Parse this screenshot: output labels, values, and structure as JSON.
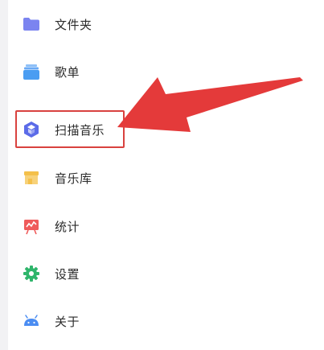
{
  "menu": {
    "items": [
      {
        "label": "文件夹",
        "icon": "folder-icon",
        "color": "#7b84f0"
      },
      {
        "label": "歌单",
        "icon": "playlist-icon",
        "color": "#4a9df2"
      },
      {
        "label": "扫描音乐",
        "icon": "scan-icon",
        "color": "#5b6be8"
      },
      {
        "label": "音乐库",
        "icon": "library-icon",
        "color": "#f4c04a"
      },
      {
        "label": "统计",
        "icon": "statistics-icon",
        "color": "#ef5b5b"
      },
      {
        "label": "设置",
        "icon": "settings-icon",
        "color": "#2fb56b"
      },
      {
        "label": "关于",
        "icon": "android-icon",
        "color": "#4b8df2"
      }
    ]
  },
  "annotation": {
    "highlight_color": "#d9423f",
    "arrow_color": "#e43a3a"
  }
}
